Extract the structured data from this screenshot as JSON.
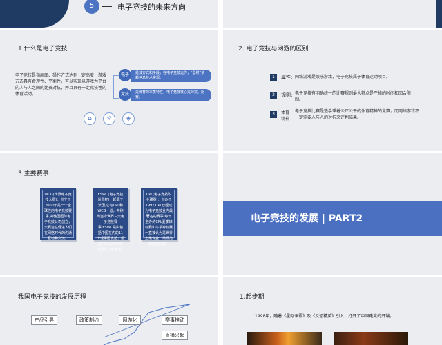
{
  "header": {
    "number": "5",
    "title": "电子竞技的未来方向"
  },
  "s1": {
    "title": "1.什么是电子竞技",
    "desc": "电子竞技是指画面、操作方式达到一定高度，游戏方式具有合理性、平衡性，可以实现以游戏为平台的人与人之间的比赛对抗，并且具有一定竞技性的体育活动。",
    "items": [
      {
        "label": "电子",
        "text": "是其方式和手段，在电子竞技运作，“器材”依赖信息技术实现。"
      },
      {
        "label": "竞技",
        "text": "是体育的本质特性，电子竞技核心是对抗、比赛。"
      }
    ],
    "icons": [
      "home-icon",
      "lightbulb-icon",
      "shield-icon"
    ]
  },
  "s2": {
    "title": "2. 电子竞技与网游的区别",
    "items": [
      {
        "num": "1",
        "label": "属性:",
        "text": "网络游戏是娱乐游戏，电子竞技属于体育运动项目。"
      },
      {
        "num": "2",
        "label": "规则:",
        "text": "电子竞技有明确统一的比赛规则最大特点是严格的时间和回合限制。"
      },
      {
        "num": "3",
        "label": "体育精神",
        "text": "电子竞技比赛是选手秉着公正公平的体育精神的竞赛，而网络游戏不一定需要人与人的对抗来评判结果。"
      }
    ]
  },
  "s3": {
    "title": "3.主要赛事",
    "cards": [
      "WCG(世界电子竞技大赛)：创立于2000年是一个全球性的电子竞技赛事,由韩国国际电子竞技公司创立，大赛旨在促进人们在网络时代的沟通互动和交流。",
      "ESWC(电子竞技世界杯)：起源于法国,它与CPL和WCG一道，并称为当今世界三大电子竞技赛事,ESWC是由包括中国在内的11个理事国发起，超过60个合作伙伴的国际文化活动。",
      "CPL(电子竞技职业联赛)：创办于1997,CPL已经成为电子竞技业内最著名的赛事,每年主办的CPL夏季锦标赛和冬季锦标赛一直被认为是世界上最专业、最规范的电竞联赛。"
    ]
  },
  "s4": {
    "banner": "电子竞技的发展 | PART2"
  },
  "s5": {
    "title": "我国电子竞技的发展历程",
    "labels": [
      "产品引导",
      "政策制约",
      "网游化",
      "赛事推动",
      "直播兴起"
    ]
  },
  "s6": {
    "title": "1.起步期",
    "text": "1998年，随着《星际争霸》及《反恐精英》引入，打开了中国电竞的开端。"
  },
  "colors": {
    "accent": "#4d74c3",
    "navy": "#1f3a63",
    "banner": "#4b70c2"
  }
}
